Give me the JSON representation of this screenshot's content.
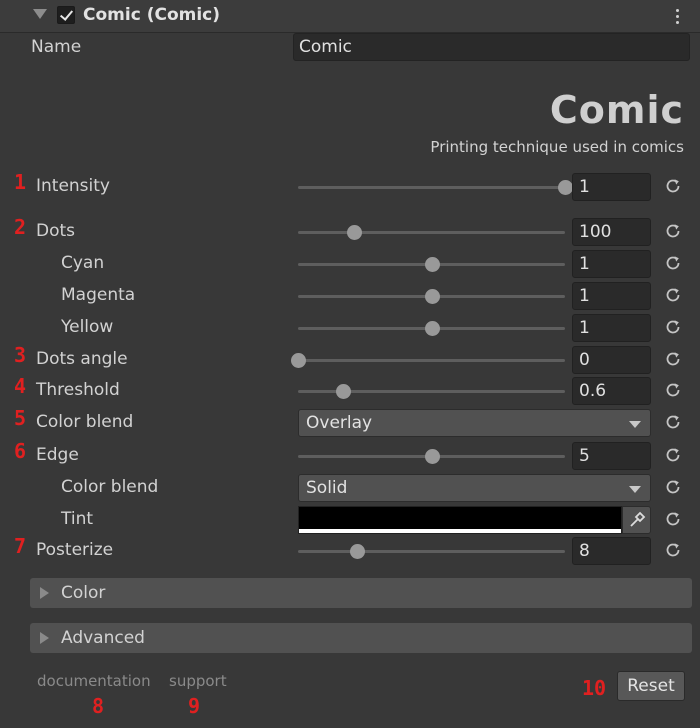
{
  "header": {
    "title": "Comic (Comic)",
    "enabled": true
  },
  "name_field": {
    "label": "Name",
    "value": "Comic"
  },
  "banner": {
    "title": "Comic",
    "subtitle": "Printing technique used in comics"
  },
  "rows": [
    {
      "num": "1",
      "label": "Intensity",
      "type": "slider",
      "value": "1",
      "level": 1.0
    },
    {
      "num": "2",
      "label": "Dots",
      "type": "slider",
      "value": "100",
      "level": 0.21
    },
    {
      "num": "",
      "label": "Cyan",
      "type": "slider",
      "value": "1",
      "level": 0.5
    },
    {
      "num": "",
      "label": "Magenta",
      "type": "slider",
      "value": "1",
      "level": 0.5
    },
    {
      "num": "",
      "label": "Yellow",
      "type": "slider",
      "value": "1",
      "level": 0.5
    },
    {
      "num": "3",
      "label": "Dots angle",
      "type": "slider",
      "value": "0",
      "level": 0.0
    },
    {
      "num": "4",
      "label": "Threshold",
      "type": "slider",
      "value": "0.6",
      "level": 0.17
    },
    {
      "num": "5",
      "label": "Color blend",
      "type": "dropdown",
      "value": "Overlay"
    },
    {
      "num": "6",
      "label": "Edge",
      "type": "slider",
      "value": "5",
      "level": 0.5
    },
    {
      "num": "",
      "label": "Color blend",
      "type": "dropdown",
      "value": "Solid"
    },
    {
      "num": "",
      "label": "Tint",
      "type": "color",
      "color": "#000000"
    },
    {
      "num": "7",
      "label": "Posterize",
      "type": "slider",
      "value": "8",
      "level": 0.22
    }
  ],
  "foldouts": [
    {
      "label": "Color"
    },
    {
      "label": "Advanced"
    }
  ],
  "footer": {
    "documentation": "documentation",
    "documentation_num": "8",
    "support": "support",
    "support_num": "9",
    "reset_num": "10",
    "reset_label": "Reset"
  },
  "colors": {
    "annotation": "#e02020",
    "panel_bg": "#383838"
  }
}
